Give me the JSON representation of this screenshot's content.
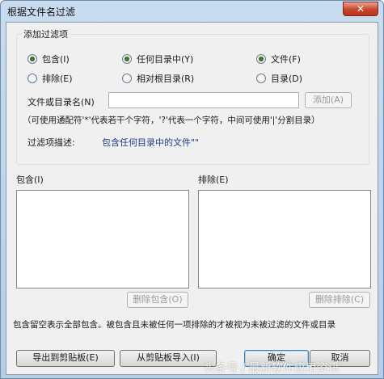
{
  "window": {
    "title": "根据文件名过滤",
    "close_glyph": "✕"
  },
  "group": {
    "legend": "添加过滤项",
    "radios": {
      "include": {
        "label": "包含(I)",
        "checked": true
      },
      "exclude": {
        "label": "排除(E)",
        "checked": false
      },
      "any_dir": {
        "label": "任何目录中(Y)",
        "checked": true
      },
      "rel_root": {
        "label": "相对根目录(R)",
        "checked": false
      },
      "file": {
        "label": "文件(F)",
        "checked": true
      },
      "dir": {
        "label": "目录(D)",
        "checked": false
      }
    },
    "name_label": "文件或目录名(N)",
    "name_value": "",
    "add_button": "添加(A)",
    "hint": "（可使用通配符'*'代表若干个字符，'?'代表一个字符，中间可使用'|'分割目录）",
    "desc_label": "过滤项描述:",
    "desc_value": "包含任何目录中的文件\"\""
  },
  "include_list": {
    "label": "包含(I)",
    "remove_button": "删除包含(O)"
  },
  "exclude_list": {
    "label": "排除(E)",
    "remove_button": "删除排除(C)"
  },
  "footer_note": "包含留空表示全部包含。被包含且未被任何一项排除的才被视为未被过滤的文件或目录",
  "buttons": {
    "export": "导出到剪贴板(E)",
    "import": "从剪贴板导入(I)",
    "ok": "确定",
    "cancel": "取消"
  },
  "watermark": "头条号 / 最新软件应用资讯"
}
